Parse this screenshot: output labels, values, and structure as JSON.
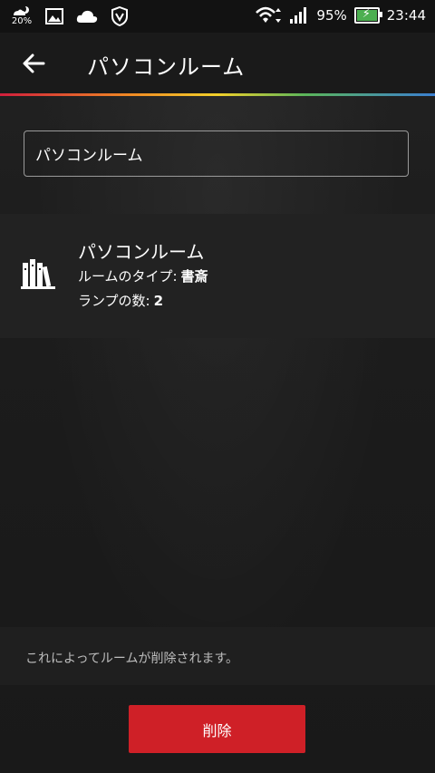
{
  "status_bar": {
    "weather_percent": "20%",
    "battery_percent": "95%",
    "time": "23:44",
    "icons": [
      "weather-icon",
      "gallery-icon",
      "cloud-icon",
      "vpn-shield-icon",
      "wifi-icon",
      "signal-icon",
      "battery-charging-icon"
    ]
  },
  "app_bar": {
    "title": "パソコンルーム"
  },
  "form": {
    "name_value": "パソコンルーム"
  },
  "room": {
    "icon": "bookshelf-icon",
    "name": "パソコンルーム",
    "type_label": "ルームのタイプ:",
    "type_value": "書斎",
    "lamps_label": "ランプの数:",
    "lamps_value": "2"
  },
  "footer": {
    "notice": "これによってルームが削除されます。",
    "delete_label": "削除"
  },
  "colors": {
    "accent_red": "#cf2027",
    "battery_green": "#4caf50"
  }
}
